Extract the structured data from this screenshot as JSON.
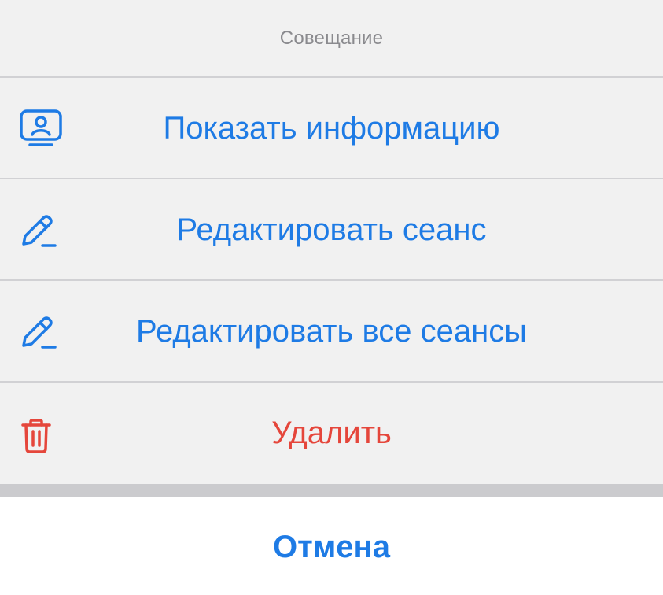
{
  "sheet": {
    "title": "Совещание",
    "actions": [
      {
        "label": "Показать информацию",
        "icon": "info-card-icon",
        "color": "#1e7be5"
      },
      {
        "label": "Редактировать сеанс",
        "icon": "pencil-icon",
        "color": "#1e7be5"
      },
      {
        "label": "Редактировать все сеансы",
        "icon": "pencil-icon",
        "color": "#1e7be5"
      },
      {
        "label": "Удалить",
        "icon": "trash-icon",
        "color": "#e5463b"
      }
    ],
    "cancel_label": "Отмена"
  }
}
